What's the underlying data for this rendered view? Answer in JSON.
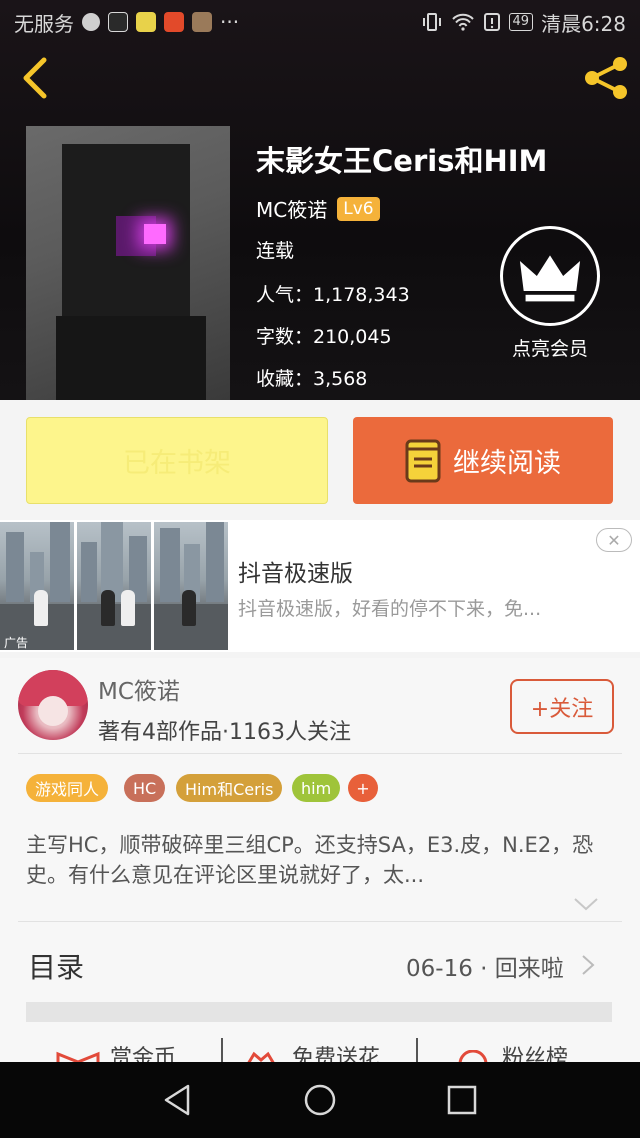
{
  "status_bar": {
    "carrier": "无服务",
    "time_label": "清晨6:28",
    "battery": "49",
    "more": "···"
  },
  "book": {
    "title": "末影女王Ceris和HIM",
    "author": "MC筱诺",
    "level": "Lv6",
    "status": "连载",
    "popularity": "人气：1,178,343",
    "word_count": "字数：210,045",
    "favorites": "收藏：3,568",
    "vip_label": "点亮会员"
  },
  "actions": {
    "shelf_label": "已在书架",
    "read_label": "继续阅读"
  },
  "ad": {
    "title": "抖音极速版",
    "description": "抖音极速版，好看的停不下来，免...",
    "tag": "广告",
    "close": "✕"
  },
  "author_card": {
    "name": "MC筱诺",
    "stats": "著有4部作品·1163人关注",
    "follow_label": "+关注",
    "tags": [
      {
        "label": "游戏同人",
        "color": "#f5b23a"
      },
      {
        "label": "HC",
        "color": "#c8705a"
      },
      {
        "label": "Him和Ceris",
        "color": "#d4a03a"
      },
      {
        "label": "him",
        "color": "#9fc43a"
      },
      {
        "label": "+",
        "color": "#e8603a"
      }
    ],
    "description": "主写HC，顺带破碎里三组CP。还支持SA，E3.皮，N.E2，恐史。有什么意见在评论区里说就好了，太..."
  },
  "toc": {
    "label": "目录",
    "latest": "06-16 · 回来啦"
  },
  "bottom_tabs": [
    "赏金币",
    "免费送花",
    "粉丝榜"
  ]
}
